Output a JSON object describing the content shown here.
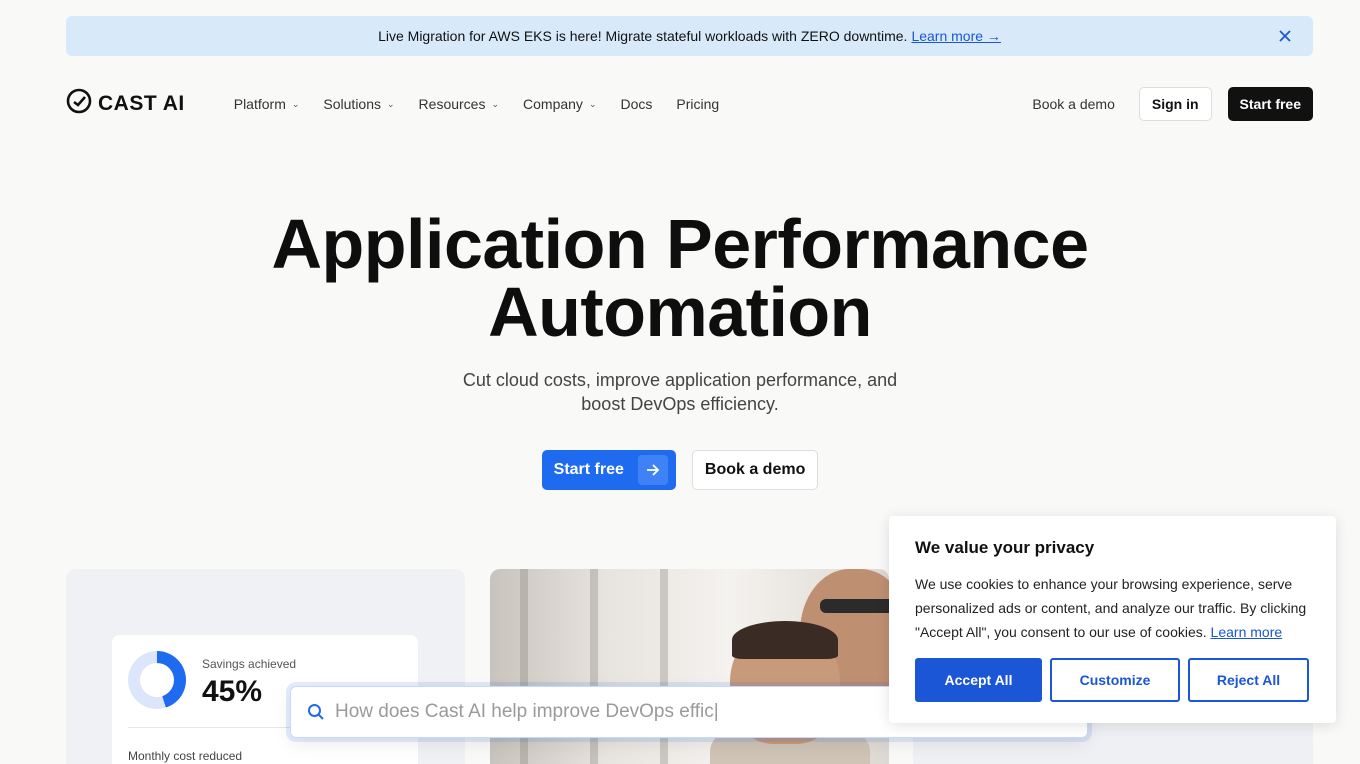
{
  "banner": {
    "text": "Live Migration for AWS EKS is here! Migrate stateful workloads with ZERO downtime.",
    "link": "Learn more →"
  },
  "nav": {
    "logo": "CAST AI",
    "menu": [
      "Platform",
      "Solutions",
      "Resources",
      "Company",
      "Docs",
      "Pricing"
    ],
    "book_demo": "Book a demo",
    "sign_in": "Sign in",
    "start_free": "Start free"
  },
  "hero": {
    "title_line1": "Application Performance",
    "title_line2": "Automation",
    "subtitle": "Cut cloud costs, improve application performance, and boost DevOps efficiency.",
    "start_free": "Start free",
    "book_demo": "Book a demo"
  },
  "savings": {
    "label": "Savings achieved",
    "value": "45%",
    "percent": 45,
    "monthly_label": "Monthly cost reduced"
  },
  "search": {
    "placeholder": "How does Cast AI help improve DevOps effic|"
  },
  "cookie": {
    "title": "We value your privacy",
    "body": "We use cookies to enhance your browsing experience, serve personalized ads or content, and analyze our traffic. By clicking \"Accept All\", you consent to our use of cookies.",
    "learn_more": "Learn more",
    "accept": "Accept All",
    "customize": "Customize",
    "reject": "Reject All"
  },
  "colors": {
    "accent": "#1f6bf0",
    "banner_bg": "#d8eaf9",
    "cookie_blue": "#1a56d6"
  }
}
